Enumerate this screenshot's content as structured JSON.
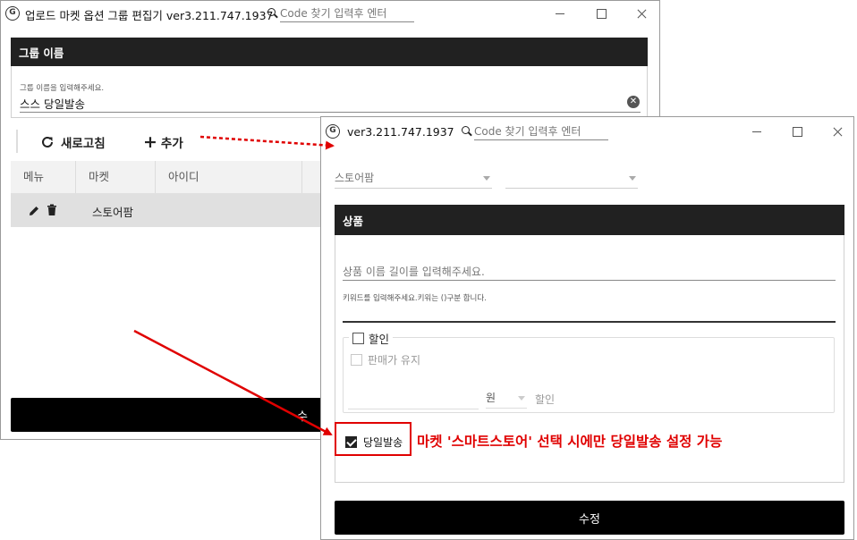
{
  "back_window": {
    "title": "업로드 마켓 옵션 그룹 편집기 ver3.211.747.1937",
    "search_placeholder": "Code 찾기 입력후 엔터",
    "group_section": {
      "header": "그룹 이름",
      "field_label": "그룹 이름을 입력해주세요.",
      "field_value": "스스 당일발송"
    },
    "toolbar": {
      "refresh_label": "새로고침",
      "add_label": "추가"
    },
    "table": {
      "columns": [
        "메뉴",
        "마켓",
        "아이디"
      ],
      "rows": [
        {
          "market": "스토어팜"
        }
      ]
    },
    "bottom_button_glyph": "수"
  },
  "front_window": {
    "title": "ver3.211.747.1937",
    "search_placeholder": "Code 찾기 입력후 엔터",
    "market_select": "스토어팜",
    "product_section": {
      "header": "상품",
      "name_placeholder": "상품 이름 길이를 입력해주세요.",
      "keyword_label": "키워드를 입력해주세요.키워는 ()구분 합니다."
    },
    "discount": {
      "label": "할인",
      "keep_price_label": "판매가 유지",
      "unit": "원",
      "suffix": "할인"
    },
    "same_day": {
      "label": "당일발송",
      "checked": true
    },
    "submit_label": "수정"
  },
  "annotation": {
    "text": "마켓 '스마트스토어' 선택 시에만 당일발송 설정 가능",
    "color": "#e00000"
  }
}
